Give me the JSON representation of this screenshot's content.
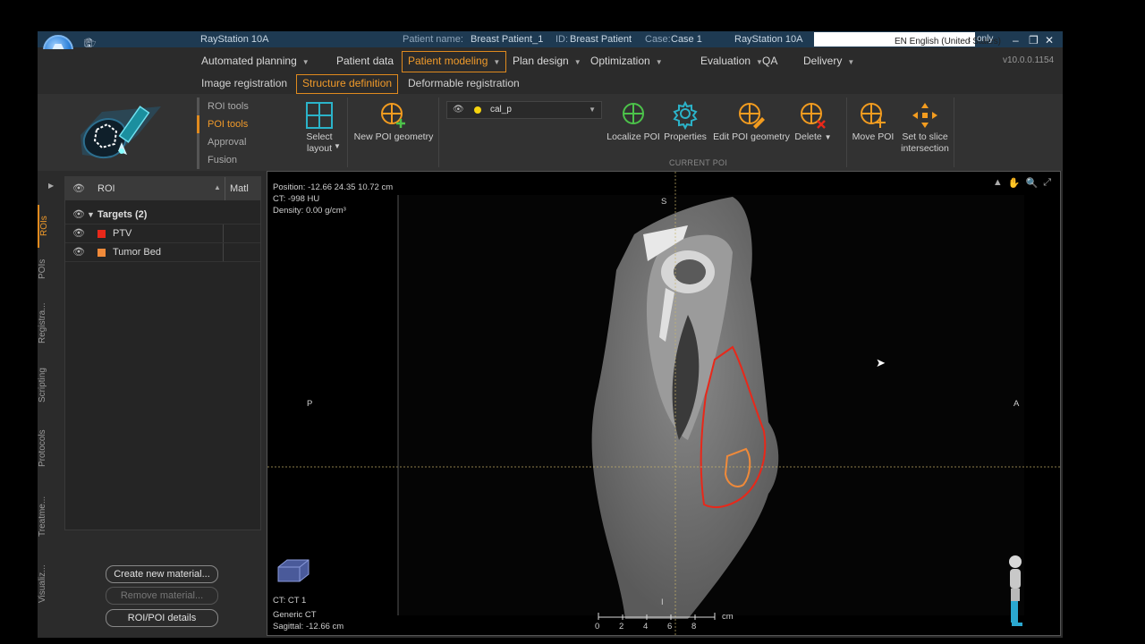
{
  "titlebar": {
    "app_name": "RayStation 10A",
    "patient_label": "Patient name:",
    "patient_name": "Breast Patient_1",
    "id_label": "ID:",
    "patient_id": "Breast Patient",
    "case_label": "Case:",
    "case_name": "Case 1",
    "app_name_2": "RayStation 10A",
    "language": "EN English (United States)",
    "suffix": "only"
  },
  "menu": {
    "items": [
      {
        "label": "Automated planning",
        "dropdown": true
      },
      {
        "label": "Patient data",
        "dropdown": false
      },
      {
        "label": "Patient modeling",
        "dropdown": true,
        "active": true
      },
      {
        "label": "Plan design",
        "dropdown": true
      },
      {
        "label": "Optimization",
        "dropdown": true
      },
      {
        "label": "Evaluation",
        "dropdown": true
      },
      {
        "label": "QA",
        "dropdown": false
      },
      {
        "label": "Delivery",
        "dropdown": true
      }
    ],
    "version": "v10.0.0.1154"
  },
  "submenu": {
    "items": [
      "Image registration",
      "Structure definition",
      "Deformable registration"
    ],
    "active": "Structure definition"
  },
  "ribbon": {
    "tools": [
      "ROI tools",
      "POI tools",
      "Approval",
      "Fusion"
    ],
    "active_tool": "POI tools",
    "select_layout": [
      "Select",
      "layout"
    ],
    "new_poi": "New POI geometry",
    "current_poi_name": "cal_p",
    "localize": "Localize POI",
    "properties": "Properties",
    "edit_poi": "Edit POI geometry",
    "delete": "Delete",
    "move_poi": "Move POI",
    "set_slice": [
      "Set to slice",
      "intersection"
    ],
    "current_poi_group": "CURRENT POI",
    "colors": {
      "accent": "#e08a1e",
      "poi_icon": "#f39c1f",
      "green_icon": "#4cc24a",
      "teal_icon": "#2bb3c9",
      "poi_dot": "#f6d40f"
    }
  },
  "side_tabs": [
    "ROIs",
    "POIs",
    "Registra...",
    "Scripting",
    "Protocols",
    "Treatme...",
    "Visualiz..."
  ],
  "roi_panel": {
    "col_roi": "ROI",
    "col_mat": "Matl",
    "group": "Targets (2)",
    "rois": [
      {
        "name": "PTV",
        "color": "#e8281a"
      },
      {
        "name": "Tumor Bed",
        "color": "#f08a3a"
      }
    ],
    "btn_create": "Create new material...",
    "btn_remove": "Remove material...",
    "btn_details": "ROI/POI details"
  },
  "viewer": {
    "position": "Position: -12.66 24.35 10.72 cm",
    "ct": "CT: -998 HU",
    "density": "Density: 0.00 g/cm³",
    "label_s": "S",
    "label_p": "P",
    "label_a": "A",
    "label_i": "I",
    "footer_ct": "CT: CT 1",
    "footer_generic": "Generic CT",
    "footer_sagittal": "Sagittal: -12.66 cm",
    "scale_unit": "cm",
    "scale_ticks": [
      "0",
      "2",
      "4",
      "6",
      "8"
    ]
  }
}
